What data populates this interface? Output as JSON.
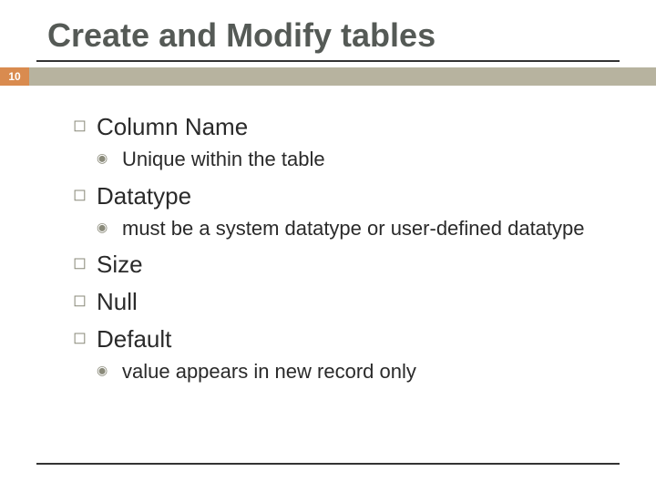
{
  "title": "Create and Modify tables",
  "page_number": "10",
  "items": {
    "i0": "Column Name",
    "i0s0": "Unique within the table",
    "i1": "Datatype",
    "i1s0": "must be a system datatype or user-defined datatype",
    "i2": "Size",
    "i3": "Null",
    "i4": "Default",
    "i4s0": "value appears in new record only"
  }
}
